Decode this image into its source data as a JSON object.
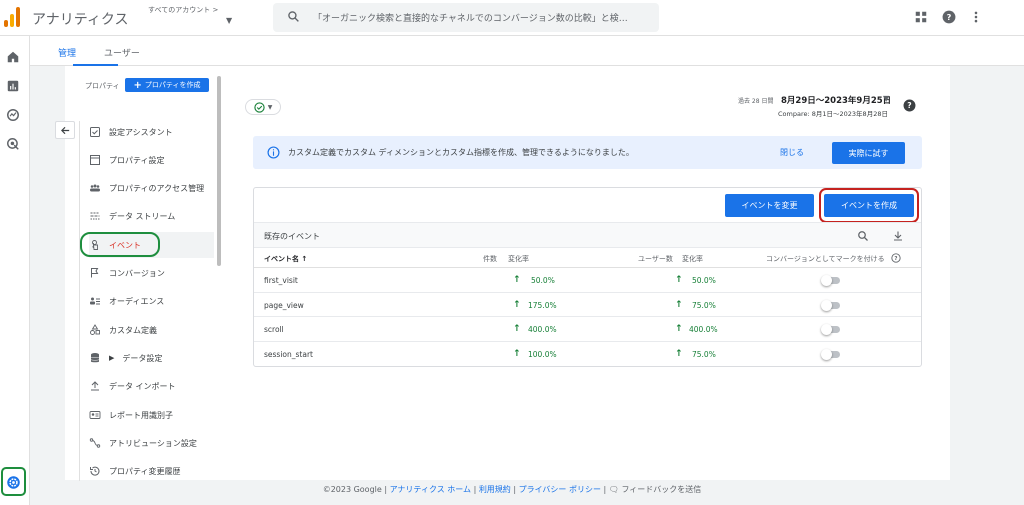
{
  "header": {
    "app_title": "アナリティクス",
    "account_label": "すべてのアカウント >",
    "search_placeholder": "「オーガニック検索と直接的なチャネルでのコンバージョン数の比較」と検…",
    "brand_colors": {
      "orange_dark": "#e37400",
      "orange_light": "#f9ab00"
    }
  },
  "tabs": [
    {
      "label": "管理",
      "active": true
    },
    {
      "label": "ユーザー",
      "active": false
    }
  ],
  "property": {
    "label": "プロパティ",
    "create_button": "プロパティを作成"
  },
  "nav_items": [
    {
      "label": "設定アシスタント",
      "icon": "checklist-icon"
    },
    {
      "label": "プロパティ設定",
      "icon": "property-settings-icon"
    },
    {
      "label": "プロパティのアクセス管理",
      "icon": "people-icon"
    },
    {
      "label": "データ ストリーム",
      "icon": "data-stream-icon"
    },
    {
      "label": "イベント",
      "icon": "touch-icon",
      "active": true
    },
    {
      "label": "コンバージョン",
      "icon": "flag-icon"
    },
    {
      "label": "オーディエンス",
      "icon": "audience-icon"
    },
    {
      "label": "カスタム定義",
      "icon": "shapes-icon"
    },
    {
      "label": "データ設定",
      "icon": "database-icon"
    },
    {
      "label": "データ インポート",
      "icon": "upload-icon"
    },
    {
      "label": "レポート用識別子",
      "icon": "id-icon"
    },
    {
      "label": "アトリビューション設定",
      "icon": "attribution-icon"
    },
    {
      "label": "プロパティ変更履歴",
      "icon": "history-icon"
    }
  ],
  "date": {
    "label": "過去 28 日間",
    "range": "8月29日～2023年9月25日",
    "compare": "Compare: 8月1日～2023年8月28日"
  },
  "banner": {
    "text": "カスタム定義でカスタム ディメンションとカスタム指標を作成、管理できるようになりました。",
    "close_label": "閉じる",
    "try_label": "実際に試す"
  },
  "events": {
    "modify_button": "イベントを変更",
    "create_button": "イベントを作成",
    "section_title": "既存のイベント",
    "columns": {
      "name": "イベント名 ↑",
      "count": "件数",
      "count_change": "変化率",
      "users": "ユーザー数",
      "users_change": "変化率",
      "conversion": "コンバージョンとしてマークを付ける"
    },
    "rows": [
      {
        "name": "first_visit",
        "count_change": "50.0%",
        "users_change": "50.0%",
        "conversion": false
      },
      {
        "name": "page_view",
        "count_change": "175.0%",
        "users_change": "75.0%",
        "conversion": false
      },
      {
        "name": "scroll",
        "count_change": "400.0%",
        "users_change": "400.0%",
        "conversion": false
      },
      {
        "name": "session_start",
        "count_change": "100.0%",
        "users_change": "75.0%",
        "conversion": false
      }
    ]
  },
  "footer": {
    "copyright": "©2023 Google",
    "home_link": "アナリティクス ホーム",
    "terms_link": "利用規約",
    "privacy_link": "プライバシー ポリシー",
    "feedback": "フィードバックを送信"
  }
}
